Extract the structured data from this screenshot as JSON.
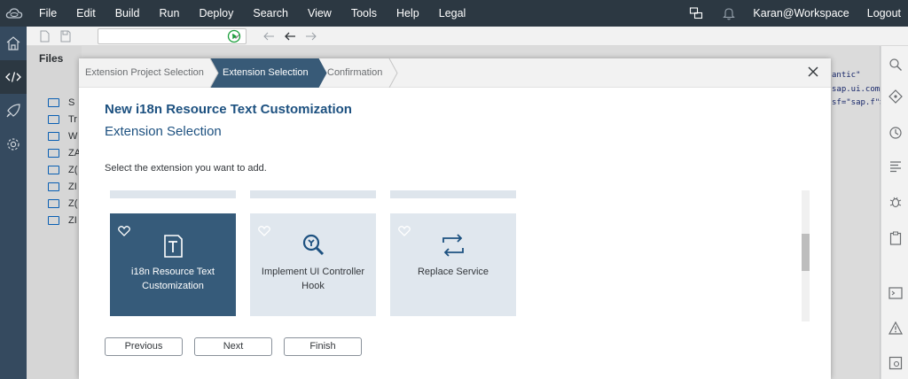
{
  "menubar": {
    "logo_icon": "cloud-icon",
    "items": [
      "File",
      "Edit",
      "Build",
      "Run",
      "Deploy",
      "Search",
      "View",
      "Tools",
      "Help",
      "Legal"
    ],
    "user": "Karan@Workspace",
    "logout": "Logout"
  },
  "leftrail": {
    "icons": [
      "home-icon",
      "code-icon",
      "rocket-icon",
      "settings-icon"
    ],
    "active": "code-icon"
  },
  "explorer": {
    "tab_label": "Files",
    "letters": [
      "S",
      "Tr",
      "W",
      "ZA",
      "Z(",
      "ZI",
      "Z(",
      "ZI"
    ]
  },
  "editor": {
    "code_lines": [
      "antic\"",
      "sap.ui.comp",
      "sf=\"sap.f\">"
    ]
  },
  "dialog": {
    "steps": [
      "Extension Project Selection",
      "Extension Selection",
      "Confirmation"
    ],
    "active_step": 1,
    "title": "New i18n Resource Text Customization",
    "subtitle": "Extension Selection",
    "instruction": "Select the extension you want to add.",
    "tiles": [
      {
        "label": "i18n Resource Text Customization",
        "icon": "text-resource-icon",
        "selected": true
      },
      {
        "label": "Implement UI Controller Hook",
        "icon": "wrench-search-icon",
        "selected": false
      },
      {
        "label": "Replace Service",
        "icon": "replace-arrows-icon",
        "selected": false
      }
    ],
    "buttons": {
      "previous": "Previous",
      "next": "Next",
      "finish": "Finish"
    }
  },
  "colors": {
    "header_bg": "#2c3842",
    "selected_tile": "#365b7a",
    "tile_bg": "#e0e7ee",
    "title_color": "#1d5180",
    "active_step": "#385a77"
  }
}
